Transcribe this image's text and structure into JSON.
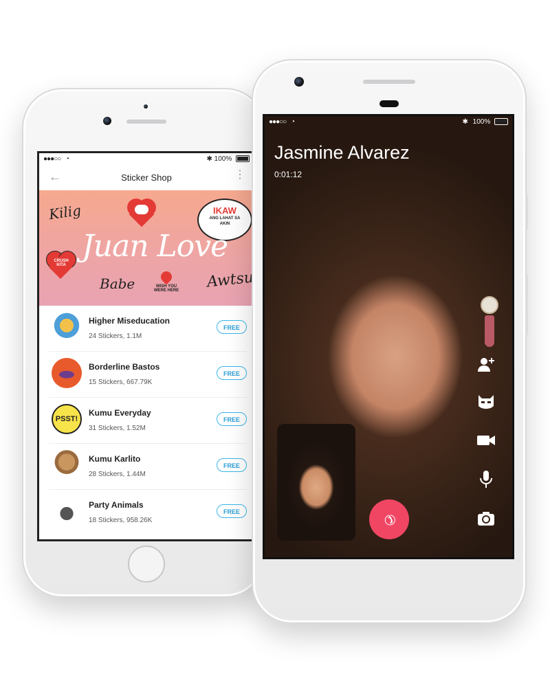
{
  "left_phone": {
    "status": {
      "signal": "●●●○○",
      "wifi": "wifi",
      "battery": "100%"
    },
    "title": "Sticker Shop",
    "back_icon": "←",
    "more_icon": "⋮",
    "banner": {
      "script_title": "Juan Love",
      "words": [
        "Kilig",
        "Babe",
        "Awtsu",
        "IKAW",
        "ANG LAHAT SA AKIN",
        "CRUSH KITA",
        "WISH YOU WERE HERE"
      ]
    },
    "packs": [
      {
        "name": "Higher Miseducation",
        "meta": "24 Stickers, 1.1M",
        "price": "FREE"
      },
      {
        "name": "Borderline Bastos",
        "meta": "15 Stickers, 667.79K",
        "price": "FREE"
      },
      {
        "name": "Kumu Everyday",
        "meta": "31 Stickers, 1.52M",
        "price": "FREE"
      },
      {
        "name": "Kumu Karlito",
        "meta": "28 Stickers, 1.44M",
        "price": "FREE"
      },
      {
        "name": "Party Animals",
        "meta": "18 Stickers, 958.26K",
        "price": "FREE"
      }
    ],
    "colors": {
      "accent": "#39b6e8",
      "banner": "#eea5a4"
    }
  },
  "right_phone": {
    "status": {
      "signal": "●●●○○",
      "bluetooth": "✱",
      "battery": "100%"
    },
    "caller": "Jasmine Alvarez",
    "timer": "0:01:12",
    "end_call_icon": "phone-hangup-icon",
    "side_icons": [
      "add-person-icon",
      "mask-icon",
      "video-camera-icon",
      "microphone-icon",
      "switch-camera-icon"
    ],
    "colors": {
      "end_call": "#f04664"
    }
  }
}
